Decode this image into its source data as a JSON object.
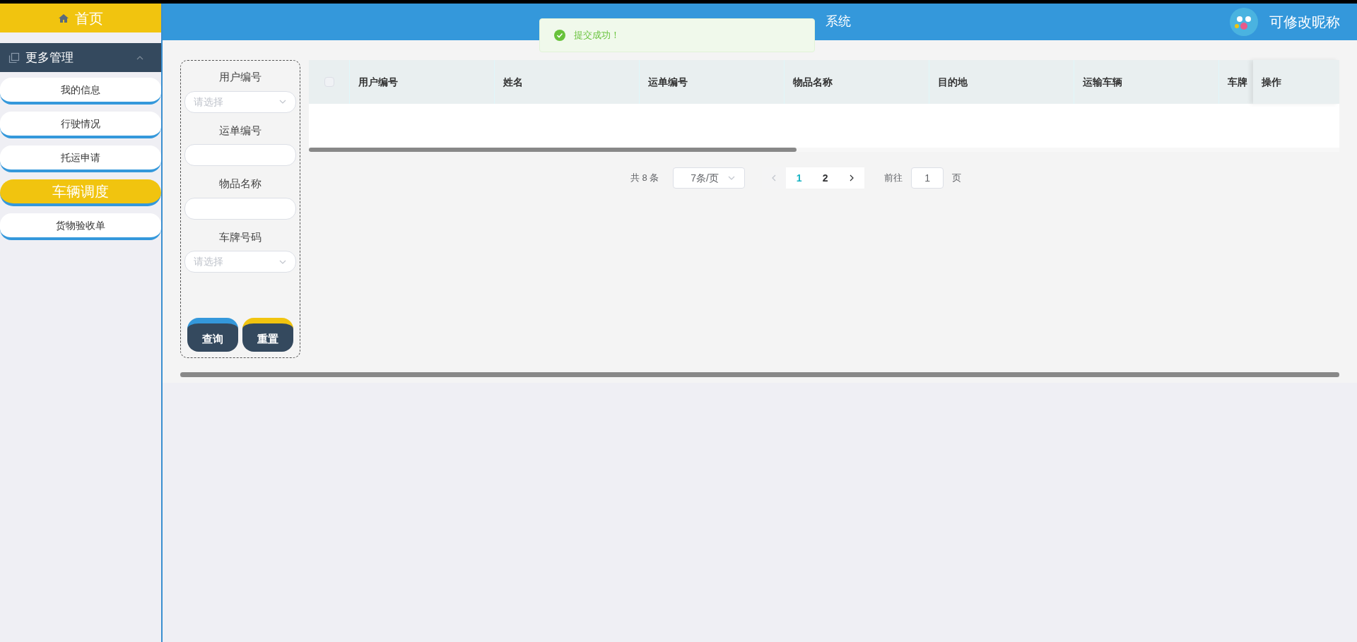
{
  "sidebar": {
    "home": "首页",
    "group": {
      "title": "更多管理",
      "expanded": true
    },
    "items": [
      {
        "label": "我的信息",
        "selected": false
      },
      {
        "label": "行驶情况",
        "selected": false
      },
      {
        "label": "托运申请",
        "selected": false
      },
      {
        "label": "车辆调度",
        "selected": true
      },
      {
        "label": "货物验收单",
        "selected": false
      }
    ]
  },
  "header": {
    "title": "系统",
    "user_name": "可修改昵称"
  },
  "toast": {
    "message": "提交成功！"
  },
  "filters": [
    {
      "label": "用户编号",
      "kind": "select",
      "placeholder": "请选择"
    },
    {
      "label": "运单编号",
      "kind": "input"
    },
    {
      "label": "物品名称",
      "kind": "input"
    },
    {
      "label": "车牌号码",
      "kind": "select",
      "placeholder": "请选择"
    }
  ],
  "buttons": [
    {
      "label": "查询",
      "color": "#3498db"
    },
    {
      "label": "重置",
      "color": "#f1c40f"
    }
  ],
  "table": {
    "select_all": {
      "checked": false
    },
    "columns": [
      "用户编号",
      "姓名",
      "运单编号",
      "物品名称",
      "目的地",
      "运输车辆",
      "车牌"
    ],
    "fixed_column": "操作"
  },
  "pagination": {
    "total": "共 8 条",
    "page_size": "7条/页",
    "prev_disabled": true,
    "pages": [
      {
        "label": "1",
        "selected": true
      },
      {
        "label": "2",
        "selected": false
      }
    ],
    "goto_label": "前往",
    "goto_value": "1",
    "goto_suffix": "页"
  }
}
